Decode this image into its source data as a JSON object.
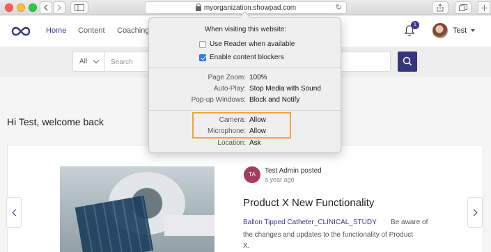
{
  "browser": {
    "url": "myorganization.showpad.com"
  },
  "nav": {
    "home": "Home",
    "content": "Content",
    "coaching": "Coaching"
  },
  "notifications": {
    "count": "1"
  },
  "user": {
    "name": "Test"
  },
  "search": {
    "filter": "All",
    "placeholder": "Search"
  },
  "welcome": "Hi Test, welcome back",
  "post": {
    "initials": "TA",
    "author": "Test Admin posted",
    "time": "a year ago",
    "title": "Product X New Functionality",
    "link": "Ballon Tipped Catheter_CLINICAL_STUDY",
    "desc_part1": "Be aware of",
    "desc_line2": "the changes and updates to the functionality of Product",
    "desc_line3": "X."
  },
  "popover": {
    "heading": "When visiting this website:",
    "reader": {
      "label": "Use Reader when available",
      "checked": false
    },
    "blockers": {
      "label": "Enable content blockers",
      "checked": true
    },
    "settings": [
      {
        "key": "Page Zoom:",
        "value": "100%"
      },
      {
        "key": "Auto-Play:",
        "value": "Stop Media with Sound"
      },
      {
        "key": "Pop-up Windows:",
        "value": "Block and Notify"
      },
      {
        "key": "Camera:",
        "value": "Allow"
      },
      {
        "key": "Microphone:",
        "value": "Allow"
      },
      {
        "key": "Location:",
        "value": "Ask"
      }
    ]
  },
  "colors": {
    "brand": "#35357d",
    "highlight": "#f0a53a",
    "checkbox": "#2f7cf6",
    "avatar_post": "#a53d63"
  }
}
